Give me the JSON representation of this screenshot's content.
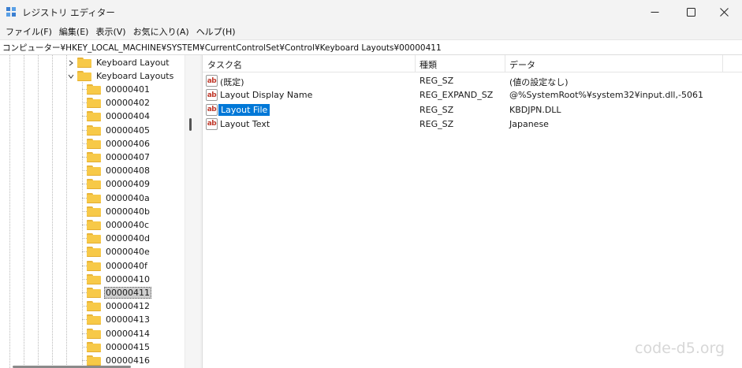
{
  "window": {
    "title": "レジストリ エディター",
    "controls": {
      "minimize_icon": "minimize-icon",
      "maximize_icon": "maximize-icon",
      "close_icon": "close-icon"
    }
  },
  "menu": [
    "ファイル(F)",
    "編集(E)",
    "表示(V)",
    "お気に入り(A)",
    "ヘルプ(H)"
  ],
  "address": "コンピューター¥HKEY_LOCAL_MACHINE¥SYSTEM¥CurrentControlSet¥Control¥Keyboard Layouts¥00000411",
  "tree": {
    "parents": [
      {
        "label": "Keyboard Layout",
        "expanded": false
      },
      {
        "label": "Keyboard Layouts",
        "expanded": true
      }
    ],
    "children": [
      "00000401",
      "00000402",
      "00000404",
      "00000405",
      "00000406",
      "00000407",
      "00000408",
      "00000409",
      "0000040a",
      "0000040b",
      "0000040c",
      "0000040d",
      "0000040e",
      "0000040f",
      "00000410",
      "00000411",
      "00000412",
      "00000413",
      "00000414",
      "00000415",
      "00000416"
    ],
    "selected": "00000411"
  },
  "list": {
    "columns": [
      "タスク名",
      "種類",
      "データ"
    ],
    "rows": [
      {
        "icon": "ab",
        "name": "(既定)",
        "type": "REG_SZ",
        "data": "(値の設定なし)",
        "selected": false
      },
      {
        "icon": "ab",
        "name": "Layout Display Name",
        "type": "REG_EXPAND_SZ",
        "data": "@%SystemRoot%¥system32¥input.dll,-5061",
        "selected": false
      },
      {
        "icon": "ab",
        "name": "Layout File",
        "type": "REG_SZ",
        "data": "KBDJPN.DLL",
        "selected": true
      },
      {
        "icon": "ab",
        "name": "Layout Text",
        "type": "REG_SZ",
        "data": "Japanese",
        "selected": false
      }
    ]
  },
  "watermark": "code-d5.org",
  "colors": {
    "selection": "#0078d7",
    "folder": "#f7c948",
    "chrome": "#f3f3f3"
  }
}
